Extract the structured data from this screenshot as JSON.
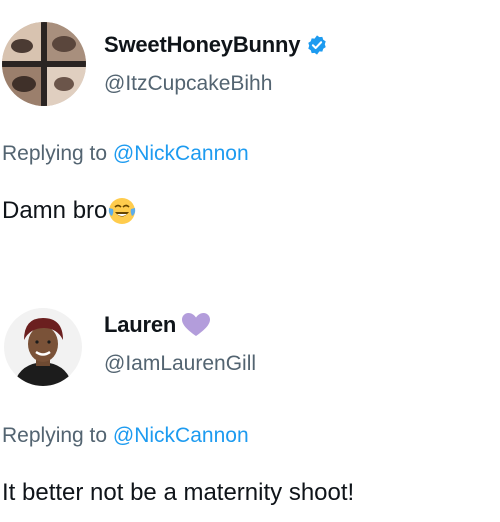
{
  "tweets": [
    {
      "display_name": "SweetHoneyBunny",
      "handle": "@ItzCupcakeBihh",
      "verified_icon": "verified-badge-icon",
      "replying_prefix": "Replying to",
      "replying_mention": "@NickCannon",
      "text": "Damn bro",
      "emoji_icon": "tears-of-joy-emoji"
    },
    {
      "display_name": "Lauren",
      "handle": "@IamLaurenGill",
      "name_emoji_icon": "purple-heart-icon",
      "replying_prefix": "Replying to",
      "replying_mention": "@NickCannon",
      "text": "It better not be a maternity shoot!"
    }
  ],
  "colors": {
    "text": "#0f1419",
    "secondary": "#536471",
    "link": "#1d9bf0",
    "verified": "#1d9bf0",
    "heart": "#b39ddb"
  }
}
